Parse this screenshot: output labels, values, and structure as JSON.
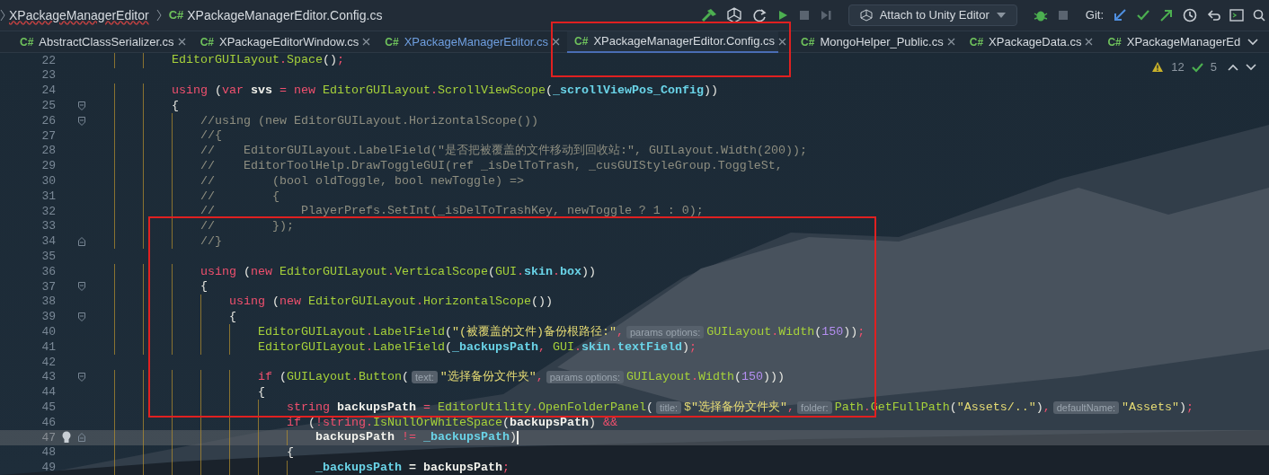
{
  "breadcrumb": {
    "items": [
      {
        "text": "XPackageManagerEditor",
        "kind": "folder"
      },
      {
        "text": "XPackageManagerEditor.Config.cs",
        "kind": "file",
        "lang": "C#"
      }
    ]
  },
  "toolbar": {
    "run_config": "Attach to Unity Editor",
    "git_label": "Git:"
  },
  "tabs": [
    {
      "lang": "C#",
      "label": "AbstractClassSerializer.cs",
      "selected": false,
      "modified": false,
      "closable": true,
      "outlined": false
    },
    {
      "lang": "C#",
      "label": "XPackageEditorWindow.cs",
      "selected": false,
      "modified": false,
      "closable": true,
      "outlined": false
    },
    {
      "lang": "C#",
      "label": "XPackageManagerEditor.cs",
      "selected": false,
      "modified": true,
      "closable": true,
      "outlined": false
    },
    {
      "lang": "C#",
      "label": "XPackageManagerEditor.Config.cs",
      "selected": true,
      "modified": false,
      "closable": true,
      "outlined": true
    },
    {
      "lang": "C#",
      "label": "MongoHelper_Public.cs",
      "selected": false,
      "modified": false,
      "closable": true,
      "outlined": false
    },
    {
      "lang": "C#",
      "label": "XPackageData.cs",
      "selected": false,
      "modified": false,
      "closable": true,
      "outlined": false
    },
    {
      "lang": "C#",
      "label": "XPackageManagerEd",
      "selected": false,
      "modified": false,
      "closable": false,
      "outlined": false
    }
  ],
  "inspections": {
    "warnings": "12",
    "ok": "5"
  },
  "code_blocks": [
    {
      "kind": "plain",
      "lines": [
        {
          "number": "22",
          "current": false,
          "fold_start": false,
          "fold_end": false,
          "bulb": false,
          "tokens": [
            {
              "kind": "type",
              "text": "            EditorGUILayout"
            },
            {
              "kind": "op",
              "text": "."
            },
            {
              "kind": "type",
              "text": "Space"
            },
            {
              "kind": "plain",
              "text": "()"
            },
            {
              "kind": "op",
              "text": ";"
            }
          ]
        },
        {
          "number": "23",
          "current": false,
          "fold_start": false,
          "fold_end": false,
          "bulb": false
        },
        {
          "number": "24",
          "current": false,
          "fold_start": false,
          "fold_end": false,
          "bulb": false,
          "tokens": [
            {
              "kind": "kw",
              "text": "            using"
            },
            {
              "kind": "plain",
              "text": " ("
            },
            {
              "kind": "kw",
              "text": "var"
            },
            {
              "kind": "ident",
              "text": " svs "
            },
            {
              "kind": "op",
              "text": "="
            },
            {
              "kind": "kw",
              "text": " new "
            },
            {
              "kind": "type",
              "text": "EditorGUILayout"
            },
            {
              "kind": "op",
              "text": "."
            },
            {
              "kind": "type",
              "text": "ScrollViewScope"
            },
            {
              "kind": "plain",
              "text": "("
            },
            {
              "kind": "field",
              "text": "_scrollViewPos_Config"
            },
            {
              "kind": "plain",
              "text": "))"
            }
          ]
        },
        {
          "number": "25",
          "current": false,
          "fold_start": true,
          "fold_end": false,
          "bulb": false,
          "tokens": [
            {
              "kind": "plain",
              "text": "            {"
            }
          ]
        },
        {
          "number": "26",
          "current": false,
          "fold_start": true,
          "fold_end": false,
          "bulb": false,
          "tokens": [
            {
              "kind": "comment",
              "text": "                //using (new EditorGUILayout.HorizontalScope())"
            }
          ]
        },
        {
          "number": "27",
          "current": false,
          "fold_start": false,
          "fold_end": false,
          "bulb": false,
          "tokens": [
            {
              "kind": "comment",
              "text": "                //{"
            }
          ]
        },
        {
          "number": "28",
          "current": false,
          "fold_start": false,
          "fold_end": false,
          "bulb": false,
          "tokens": [
            {
              "kind": "comment",
              "text": "                //    EditorGUILayout.LabelField(\"是否把被覆盖的文件移动到回收站:\", GUILayout.Width(200));"
            }
          ]
        },
        {
          "number": "29",
          "current": false,
          "fold_start": false,
          "fold_end": false,
          "bulb": false,
          "tokens": [
            {
              "kind": "comment",
              "text": "                //    EditorToolHelp.DrawToggleGUI(ref _isDelToTrash, _cusGUIStyleGroup.ToggleSt,"
            }
          ]
        },
        {
          "number": "30",
          "current": false,
          "fold_start": false,
          "fold_end": false,
          "bulb": false,
          "tokens": [
            {
              "kind": "comment",
              "text": "                //        (bool oldToggle, bool newToggle) =>"
            }
          ]
        },
        {
          "number": "31",
          "current": false,
          "fold_start": false,
          "fold_end": false,
          "bulb": false,
          "tokens": [
            {
              "kind": "comment",
              "text": "                //        {"
            }
          ]
        },
        {
          "number": "32",
          "current": false,
          "fold_start": false,
          "fold_end": false,
          "bulb": false,
          "tokens": [
            {
              "kind": "comment",
              "text": "                //            PlayerPrefs.SetInt(_isDelToTrashKey, newToggle ? 1 : 0);"
            }
          ]
        }
      ]
    },
    {
      "kind": "framed",
      "lines": [
        {
          "number": "33",
          "current": false,
          "fold_start": false,
          "fold_end": false,
          "bulb": false,
          "tokens": [
            {
              "kind": "comment",
              "text": "                //        });"
            }
          ]
        },
        {
          "number": "34",
          "current": false,
          "fold_start": false,
          "fold_end": true,
          "bulb": false,
          "tokens": [
            {
              "kind": "comment",
              "text": "                //}"
            }
          ]
        },
        {
          "number": "35",
          "current": false,
          "fold_start": false,
          "fold_end": false,
          "bulb": false
        },
        {
          "number": "36",
          "current": false,
          "fold_start": false,
          "fold_end": false,
          "bulb": false,
          "tokens": [
            {
              "kind": "kw",
              "text": "                using"
            },
            {
              "kind": "plain",
              "text": " ("
            },
            {
              "kind": "kw",
              "text": "new "
            },
            {
              "kind": "type",
              "text": "EditorGUILayout"
            },
            {
              "kind": "op",
              "text": "."
            },
            {
              "kind": "type",
              "text": "VerticalScope"
            },
            {
              "kind": "plain",
              "text": "("
            },
            {
              "kind": "type",
              "text": "GUI"
            },
            {
              "kind": "op",
              "text": "."
            },
            {
              "kind": "field",
              "text": "skin"
            },
            {
              "kind": "op",
              "text": "."
            },
            {
              "kind": "field",
              "text": "box"
            },
            {
              "kind": "plain",
              "text": "))"
            }
          ]
        },
        {
          "number": "37",
          "current": false,
          "fold_start": true,
          "fold_end": false,
          "bulb": false,
          "tokens": [
            {
              "kind": "plain",
              "text": "                {"
            }
          ]
        },
        {
          "number": "38",
          "current": false,
          "fold_start": false,
          "fold_end": false,
          "bulb": false,
          "tokens": [
            {
              "kind": "kw",
              "text": "                    using"
            },
            {
              "kind": "plain",
              "text": " ("
            },
            {
              "kind": "kw",
              "text": "new "
            },
            {
              "kind": "type",
              "text": "EditorGUILayout"
            },
            {
              "kind": "op",
              "text": "."
            },
            {
              "kind": "type",
              "text": "HorizontalScope"
            },
            {
              "kind": "plain",
              "text": "())"
            }
          ]
        },
        {
          "number": "39",
          "current": false,
          "fold_start": true,
          "fold_end": false,
          "bulb": false,
          "tokens": [
            {
              "kind": "plain",
              "text": "                    {"
            }
          ]
        },
        {
          "number": "40",
          "current": false,
          "fold_start": false,
          "fold_end": false,
          "bulb": false,
          "tokens": [
            {
              "kind": "type",
              "text": "                        EditorGUILayout"
            },
            {
              "kind": "op",
              "text": "."
            },
            {
              "kind": "type",
              "text": "LabelField"
            },
            {
              "kind": "plain",
              "text": "("
            },
            {
              "kind": "str",
              "text": "\"(被覆盖的文件)备份根路径:\""
            },
            {
              "kind": "op",
              "text": ","
            },
            {
              "kind": "hint",
              "text": "params options:"
            },
            {
              "kind": "type",
              "text": "GUILayout"
            },
            {
              "kind": "op",
              "text": "."
            },
            {
              "kind": "type",
              "text": "Width"
            },
            {
              "kind": "plain",
              "text": "("
            },
            {
              "kind": "num",
              "text": "150"
            },
            {
              "kind": "plain",
              "text": "))"
            },
            {
              "kind": "op",
              "text": ";"
            }
          ]
        },
        {
          "number": "41",
          "current": false,
          "fold_start": false,
          "fold_end": false,
          "bulb": false,
          "tokens": [
            {
              "kind": "type",
              "text": "                        EditorGUILayout"
            },
            {
              "kind": "op",
              "text": "."
            },
            {
              "kind": "type",
              "text": "LabelField"
            },
            {
              "kind": "plain",
              "text": "("
            },
            {
              "kind": "field",
              "text": "_backupsPath"
            },
            {
              "kind": "op",
              "text": ", "
            },
            {
              "kind": "type",
              "text": "GUI"
            },
            {
              "kind": "op",
              "text": "."
            },
            {
              "kind": "field",
              "text": "skin"
            },
            {
              "kind": "op",
              "text": "."
            },
            {
              "kind": "field",
              "text": "textField"
            },
            {
              "kind": "plain",
              "text": ")"
            },
            {
              "kind": "op",
              "text": ";"
            }
          ]
        },
        {
          "number": "42",
          "current": false,
          "fold_start": false,
          "fold_end": false,
          "bulb": false
        },
        {
          "number": "43",
          "current": false,
          "fold_start": true,
          "fold_end": false,
          "bulb": false,
          "tokens": [
            {
              "kind": "kw",
              "text": "                        if"
            },
            {
              "kind": "plain",
              "text": " ("
            },
            {
              "kind": "type",
              "text": "GUILayout"
            },
            {
              "kind": "op",
              "text": "."
            },
            {
              "kind": "type",
              "text": "Button"
            },
            {
              "kind": "plain",
              "text": "("
            },
            {
              "kind": "hint",
              "text": "text:"
            },
            {
              "kind": "str",
              "text": "\"选择备份文件夹\""
            },
            {
              "kind": "op",
              "text": ","
            },
            {
              "kind": "hint",
              "text": "params options:"
            },
            {
              "kind": "type",
              "text": "GUILayout"
            },
            {
              "kind": "op",
              "text": "."
            },
            {
              "kind": "type",
              "text": "Width"
            },
            {
              "kind": "plain",
              "text": "("
            },
            {
              "kind": "num",
              "text": "150"
            },
            {
              "kind": "plain",
              "text": ")))"
            }
          ]
        },
        {
          "number": "44",
          "current": false,
          "fold_start": false,
          "fold_end": false,
          "bulb": false,
          "tokens": [
            {
              "kind": "plain",
              "text": "                        {"
            }
          ]
        },
        {
          "number": "45",
          "current": false,
          "fold_start": false,
          "fold_end": false,
          "bulb": false,
          "tokens": [
            {
              "kind": "kw",
              "text": "                            string"
            },
            {
              "kind": "ident",
              "text": " backupsPath "
            },
            {
              "kind": "op",
              "text": "= "
            },
            {
              "kind": "type",
              "text": "EditorUtility"
            },
            {
              "kind": "op",
              "text": "."
            },
            {
              "kind": "type",
              "text": "OpenFolderPanel"
            },
            {
              "kind": "plain",
              "text": "("
            },
            {
              "kind": "hint",
              "text": "title:"
            },
            {
              "kind": "str",
              "text": "$\"选择备份文件夹\""
            },
            {
              "kind": "op",
              "text": ","
            },
            {
              "kind": "hint",
              "text": "folder:"
            },
            {
              "kind": "type",
              "text": "Path"
            },
            {
              "kind": "op",
              "text": "."
            },
            {
              "kind": "type",
              "text": "GetFullPath"
            },
            {
              "kind": "plain",
              "text": "("
            },
            {
              "kind": "str",
              "text": "\"Assets/..\""
            },
            {
              "kind": "plain",
              "text": ")"
            },
            {
              "kind": "op",
              "text": ","
            },
            {
              "kind": "hint",
              "text": "defaultName:"
            },
            {
              "kind": "str",
              "text": "\"Assets\""
            },
            {
              "kind": "plain",
              "text": ")"
            },
            {
              "kind": "op",
              "text": ";"
            }
          ]
        }
      ]
    },
    {
      "kind": "plain",
      "lines": [
        {
          "number": "46",
          "current": false,
          "fold_start": false,
          "fold_end": false,
          "bulb": false,
          "tokens": [
            {
              "kind": "kw",
              "text": "                            if"
            },
            {
              "kind": "plain",
              "text": " ("
            },
            {
              "kind": "op",
              "text": "!"
            },
            {
              "kind": "kw",
              "text": "string"
            },
            {
              "kind": "op",
              "text": "."
            },
            {
              "kind": "type",
              "text": "IsNullOrWhiteSpace"
            },
            {
              "kind": "plain",
              "text": "("
            },
            {
              "kind": "ident",
              "text": "backupsPath"
            },
            {
              "kind": "plain",
              "text": ") "
            },
            {
              "kind": "op",
              "text": "&&"
            }
          ]
        },
        {
          "number": "47",
          "current": true,
          "fold_start": false,
          "fold_end": true,
          "bulb": true,
          "tokens": [
            {
              "kind": "ident",
              "text": "                                backupsPath "
            },
            {
              "kind": "op",
              "text": "!= "
            },
            {
              "kind": "field",
              "text": "_backupsPath"
            },
            {
              "kind": "plain",
              "text": ")"
            }
          ]
        },
        {
          "number": "48",
          "current": false,
          "fold_start": false,
          "fold_end": false,
          "bulb": false,
          "tokens": [
            {
              "kind": "plain",
              "text": "                            {"
            }
          ]
        },
        {
          "number": "49",
          "current": false,
          "fold_start": false,
          "fold_end": false,
          "bulb": false,
          "tokens": [
            {
              "kind": "field",
              "text": "                                _backupsPath"
            },
            {
              "kind": "ident",
              "text": " = backupsPath"
            },
            {
              "kind": "op",
              "text": ";"
            }
          ]
        }
      ]
    }
  ]
}
